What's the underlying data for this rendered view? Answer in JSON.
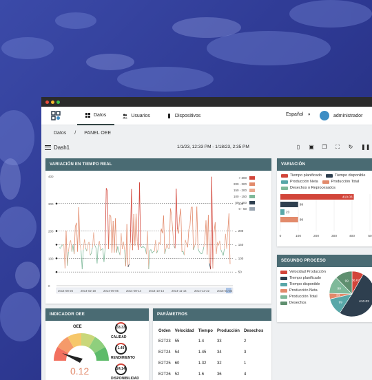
{
  "colors": {
    "header_bar": "#4a6b73",
    "accent_red": "#d2453a",
    "dark_navy": "#2e3f4f",
    "orange": "#e28a6b",
    "teal": "#58a7a8",
    "green": "#7fb99a"
  },
  "appbar": {
    "tabs": [
      {
        "label": "Datos",
        "icon": "grid-icon"
      },
      {
        "label": "Usuarios",
        "icon": "users-icon"
      },
      {
        "label": "Dispositivos",
        "icon": "device-icon"
      }
    ],
    "language": "Español",
    "username": "administrador"
  },
  "breadcrumb": [
    "Datos",
    "/",
    "PANEL OEE"
  ],
  "dashboard": {
    "name": "Dash1",
    "date_range": "1/1/23, 12:33 PM - 1/18/23, 2:35 PM"
  },
  "panels": {
    "realtime": "VARIACIÓN EN TIEMPO REAL",
    "variation": "VARIACIÓN",
    "second_process": "SEGUNDO PROCESO",
    "oee_indicator": "INDICADOR OEE",
    "parameters": "PARÁMETROS"
  },
  "chart_data": [
    {
      "type": "line",
      "y_ticks": [
        "400",
        "300",
        "200",
        "100",
        "0"
      ],
      "ylim": [
        0,
        400
      ],
      "x_ticks": [
        "2014-08-26",
        "2014-02-18",
        "2014-06-05",
        "2014-08-14",
        "2014-10-14",
        "2014-11-14",
        "2014-12-22",
        "2015-01-02"
      ],
      "threshold_lines": [
        "300",
        "200",
        "150",
        "100",
        "50"
      ],
      "legend": [
        {
          "label": "> 300",
          "color": "#d2453a"
        },
        {
          "label": "200 - 300",
          "color": "#e28a6b"
        },
        {
          "label": "150 - 200",
          "color": "#e9a98f"
        },
        {
          "label": "100 - 150",
          "color": "#7fb99a"
        },
        {
          "label": "50 - 100",
          "color": "#2e3f4f"
        },
        {
          "label": "0 - 50",
          "color": "#9aa6b2"
        }
      ]
    },
    {
      "type": "bar",
      "legend": [
        {
          "label": "Tiempo planificado",
          "color": "#d2453a"
        },
        {
          "label": "Tiempo disponible",
          "color": "#2e3f4f"
        },
        {
          "label": "Producción Neta",
          "color": "#58a7a8"
        },
        {
          "label": "Producción Total",
          "color": "#e28a6b"
        },
        {
          "label": "Desechos o Reprocesados",
          "color": "#7fb99a"
        }
      ],
      "values": [
        410.03,
        99,
        23,
        99,
        0
      ],
      "bar_labels": [
        "410.03",
        "99",
        "23",
        "99",
        ""
      ],
      "x_ticks": [
        "0",
        "100",
        "200",
        "300",
        "400",
        "50"
      ],
      "xlim": [
        0,
        500
      ]
    },
    {
      "type": "pie",
      "legend": [
        {
          "label": "Velocidad Producción",
          "color": "#d2453a"
        },
        {
          "label": "Tiempo planificado",
          "color": "#2e3f4f"
        },
        {
          "label": "Tiempo disponible",
          "color": "#58a7a8"
        },
        {
          "label": "Producción Neta",
          "color": "#e28a6b"
        },
        {
          "label": "Producción Total",
          "color": "#7fb99a"
        },
        {
          "label": "Desechos",
          "color": "#5f8f6f"
        }
      ],
      "values": [
        66.67,
        410.03,
        99,
        33,
        99,
        99
      ],
      "labels": [
        "66.67",
        "410.03",
        "99",
        "33",
        "99",
        "99"
      ]
    }
  ],
  "oee": {
    "gauge_label": "OEE",
    "gauge_value": "0.12",
    "gauge_fraction": 0.12,
    "kpis": [
      {
        "value": "33.33",
        "label": "CALIDAD"
      },
      {
        "value": "1.49",
        "label": "RENDIMIENTO"
      },
      {
        "value": "24.14",
        "label": "DISPONIBILIDAD"
      }
    ]
  },
  "parameters": {
    "columns": [
      "Orden",
      "Velocidad",
      "Tiempo",
      "Producción",
      "Desechos"
    ],
    "rows": [
      [
        "E2T23",
        "55",
        "1.4",
        "33",
        "2"
      ],
      [
        "E2T24",
        "54",
        "1.45",
        "34",
        "3"
      ],
      [
        "E2T25",
        "60",
        "1.32",
        "32",
        "1"
      ],
      [
        "E2T26",
        "52",
        "1.6",
        "36",
        "4"
      ]
    ]
  }
}
